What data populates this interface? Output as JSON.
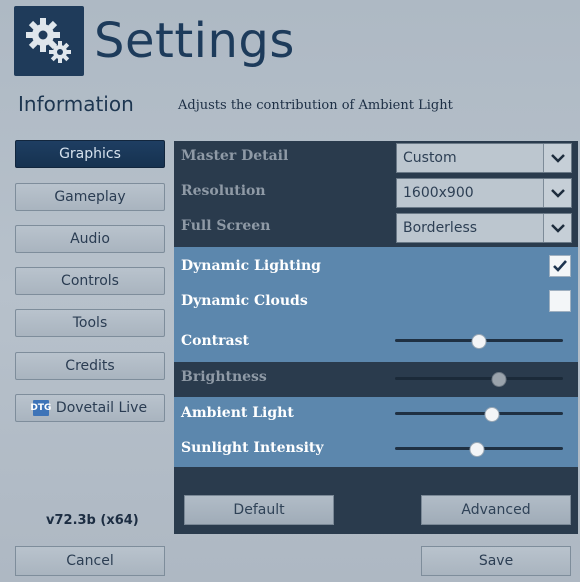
{
  "header": {
    "title": "Settings",
    "icon": "gears-icon"
  },
  "info": {
    "label": "Information",
    "description": "Adjusts the contribution of Ambient Light"
  },
  "nav": [
    {
      "label": "Graphics",
      "active": true
    },
    {
      "label": "Gameplay"
    },
    {
      "label": "Audio"
    },
    {
      "label": "Controls"
    },
    {
      "label": "Tools"
    },
    {
      "label": "Credits"
    },
    {
      "label": "Dovetail Live",
      "icon": "dovetail-live-icon",
      "icon_text": "DTG"
    }
  ],
  "version": "v72.3b (x64)",
  "settings": {
    "master_detail": {
      "label": "Master Detail",
      "value": "Custom"
    },
    "resolution": {
      "label": "Resolution",
      "value": "1600x900"
    },
    "full_screen": {
      "label": "Full Screen",
      "value": "Borderless"
    },
    "dynamic_lighting": {
      "label": "Dynamic Lighting",
      "checked": true
    },
    "dynamic_clouds": {
      "label": "Dynamic Clouds",
      "checked": false
    },
    "contrast": {
      "label": "Contrast",
      "level": 0.5
    },
    "brightness": {
      "label": "Brightness",
      "level": 0.62
    },
    "ambient_light": {
      "label": "Ambient Light",
      "level": 0.58
    },
    "sunlight_intensity": {
      "label": "Sunlight Intensity",
      "level": 0.49
    }
  },
  "buttons": {
    "default": "Default",
    "advanced": "Advanced",
    "cancel": "Cancel",
    "save": "Save"
  },
  "colors": {
    "panel": "#2a3b4d",
    "highlight": "#5c87ad",
    "active_nav": "#1e3e62",
    "title": "#1d3b5b"
  }
}
